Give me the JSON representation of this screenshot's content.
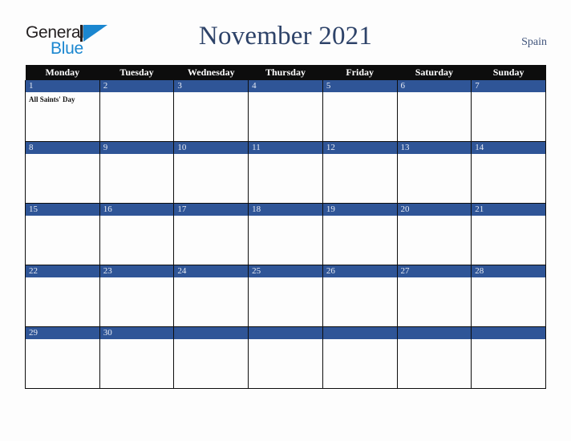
{
  "brand": {
    "name_part1": "General",
    "name_part2": "Blue",
    "triangle_icon": "triangle-icon",
    "blue_color": "#1b87d0",
    "dark_color": "#231f20"
  },
  "header": {
    "title": "November 2021",
    "country": "Spain",
    "title_color": "#2e4369"
  },
  "calendar": {
    "weekday_headers": [
      "Monday",
      "Tuesday",
      "Wednesday",
      "Thursday",
      "Friday",
      "Saturday",
      "Sunday"
    ],
    "header_bg": "#0d0d0d",
    "daynum_bg": "#2f5597",
    "cell_bg": "#fdfdfd",
    "weeks": [
      [
        {
          "day": "1",
          "events": [
            "All Saints' Day"
          ]
        },
        {
          "day": "2",
          "events": []
        },
        {
          "day": "3",
          "events": []
        },
        {
          "day": "4",
          "events": []
        },
        {
          "day": "5",
          "events": []
        },
        {
          "day": "6",
          "events": []
        },
        {
          "day": "7",
          "events": []
        }
      ],
      [
        {
          "day": "8",
          "events": []
        },
        {
          "day": "9",
          "events": []
        },
        {
          "day": "10",
          "events": []
        },
        {
          "day": "11",
          "events": []
        },
        {
          "day": "12",
          "events": []
        },
        {
          "day": "13",
          "events": []
        },
        {
          "day": "14",
          "events": []
        }
      ],
      [
        {
          "day": "15",
          "events": []
        },
        {
          "day": "16",
          "events": []
        },
        {
          "day": "17",
          "events": []
        },
        {
          "day": "18",
          "events": []
        },
        {
          "day": "19",
          "events": []
        },
        {
          "day": "20",
          "events": []
        },
        {
          "day": "21",
          "events": []
        }
      ],
      [
        {
          "day": "22",
          "events": []
        },
        {
          "day": "23",
          "events": []
        },
        {
          "day": "24",
          "events": []
        },
        {
          "day": "25",
          "events": []
        },
        {
          "day": "26",
          "events": []
        },
        {
          "day": "27",
          "events": []
        },
        {
          "day": "28",
          "events": []
        }
      ],
      [
        {
          "day": "29",
          "events": []
        },
        {
          "day": "30",
          "events": []
        },
        {
          "day": "",
          "events": []
        },
        {
          "day": "",
          "events": []
        },
        {
          "day": "",
          "events": []
        },
        {
          "day": "",
          "events": []
        },
        {
          "day": "",
          "events": []
        }
      ]
    ]
  }
}
